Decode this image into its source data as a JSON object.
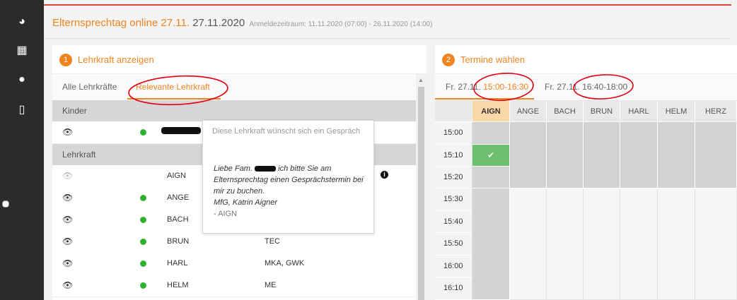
{
  "nav": {
    "items": [
      {
        "icon": "dashboard-icon",
        "glyph": "◕"
      },
      {
        "icon": "calendar-icon",
        "glyph": "▦"
      },
      {
        "icon": "chat-icon",
        "glyph": "●"
      },
      {
        "icon": "book-icon",
        "glyph": "▯"
      }
    ]
  },
  "header": {
    "title": "Elternsprechtag online 27.11.",
    "date": "27.11.2020",
    "period": "Anmeldezeitraum: 11.11.2020 (07:00) - 26.11.2020 (14:00)"
  },
  "left": {
    "step": "1",
    "title": "Lehrkraft anzeigen",
    "tab_all": "Alle Lehrkräfte",
    "tab_relevant": "Relevante Lehrkraft",
    "section_kinder": "Kinder",
    "section_lehrkraft": "Lehrkraft",
    "eye": "👁",
    "teachers": [
      {
        "kurz": "AIGN",
        "fach": "",
        "active": false
      },
      {
        "kurz": "ANGE",
        "fach": "",
        "active": true
      },
      {
        "kurz": "BACH",
        "fach": "",
        "active": true
      },
      {
        "kurz": "BRUN",
        "fach": "TEC",
        "active": true
      },
      {
        "kurz": "HARL",
        "fach": "MKA, GWK",
        "active": true
      },
      {
        "kurz": "HELM",
        "fach": "ME",
        "active": true
      }
    ],
    "info_glyph": "i",
    "scroll_up": "▲"
  },
  "tooltip": {
    "headline": "Diese Lehrkraft wünscht sich ein Gespräch",
    "msg_a": "Liebe Fam.",
    "msg_b": "ich bitte Sie am Elternsprechtag einen Gesprächstermin bei mir zu buchen.",
    "msg_c": "MfG, Katrin Aigner",
    "signature": "- AIGN"
  },
  "right": {
    "step": "2",
    "title": "Termine wählen",
    "tab1_prefix": "Fr. 27.11.",
    "tab1_time": "15:00-16:30",
    "tab2_prefix": "Fr. 27.11.",
    "tab2_time": "16:40-18:00",
    "columns": [
      "AIGN",
      "ANGE",
      "BACH",
      "BRUN",
      "HARL",
      "HELM",
      "HERZ"
    ],
    "times": [
      "15:00",
      "15:10",
      "15:20",
      "15:30",
      "15:40",
      "15:50",
      "16:00",
      "16:10"
    ],
    "check": "✔"
  },
  "colors": {
    "accent": "#f0841f",
    "booked": "#6dc06d",
    "annotation": "#e0000f"
  }
}
